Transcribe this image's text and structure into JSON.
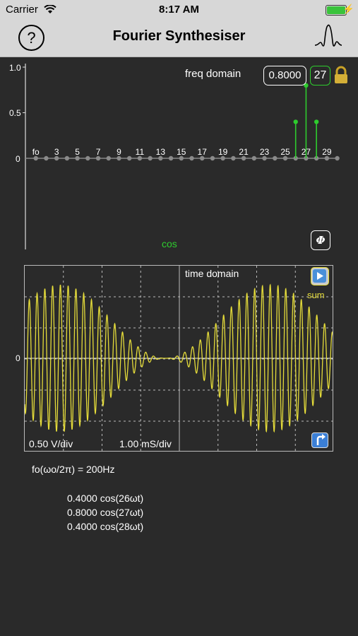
{
  "status": {
    "carrier": "Carrier",
    "time": "8:17 AM"
  },
  "nav": {
    "title": "Fourier Synthesiser",
    "help_label": "?"
  },
  "freq": {
    "label": "freq domain",
    "amplitude_value": "0.8000",
    "harmonic": "27",
    "y_labels": [
      "1.0",
      "0.5",
      "0"
    ],
    "x_labels": [
      "fo",
      "3",
      "5",
      "7",
      "9",
      "11",
      "13",
      "15",
      "17",
      "19",
      "21",
      "23",
      "25",
      "27",
      "29"
    ],
    "function_label": "cos",
    "phi_label": "Φ"
  },
  "chart_data": {
    "type": "bar",
    "title": "freq domain",
    "categories": [
      25,
      26,
      27,
      28
    ],
    "values": [
      0,
      0.4,
      0.8,
      0.4
    ],
    "ylim": [
      0,
      1.0
    ],
    "xlim": [
      1,
      30
    ]
  },
  "time": {
    "label": "time domain",
    "sum_label": "sum",
    "volts_div": "0.50 V/div",
    "time_div": "1.00 mS/div",
    "zero_label": "0"
  },
  "info": {
    "fundamental": "fo(ωo/2π) = 200Hz",
    "components": [
      "0.4000 cos(26ωt)",
      "0.8000 cos(27ωt)",
      "0.4000 cos(28ωt)"
    ]
  },
  "colors": {
    "accent": "#2ecc2e",
    "wave": "#e5dc3a",
    "background": "#2a2a2a"
  }
}
